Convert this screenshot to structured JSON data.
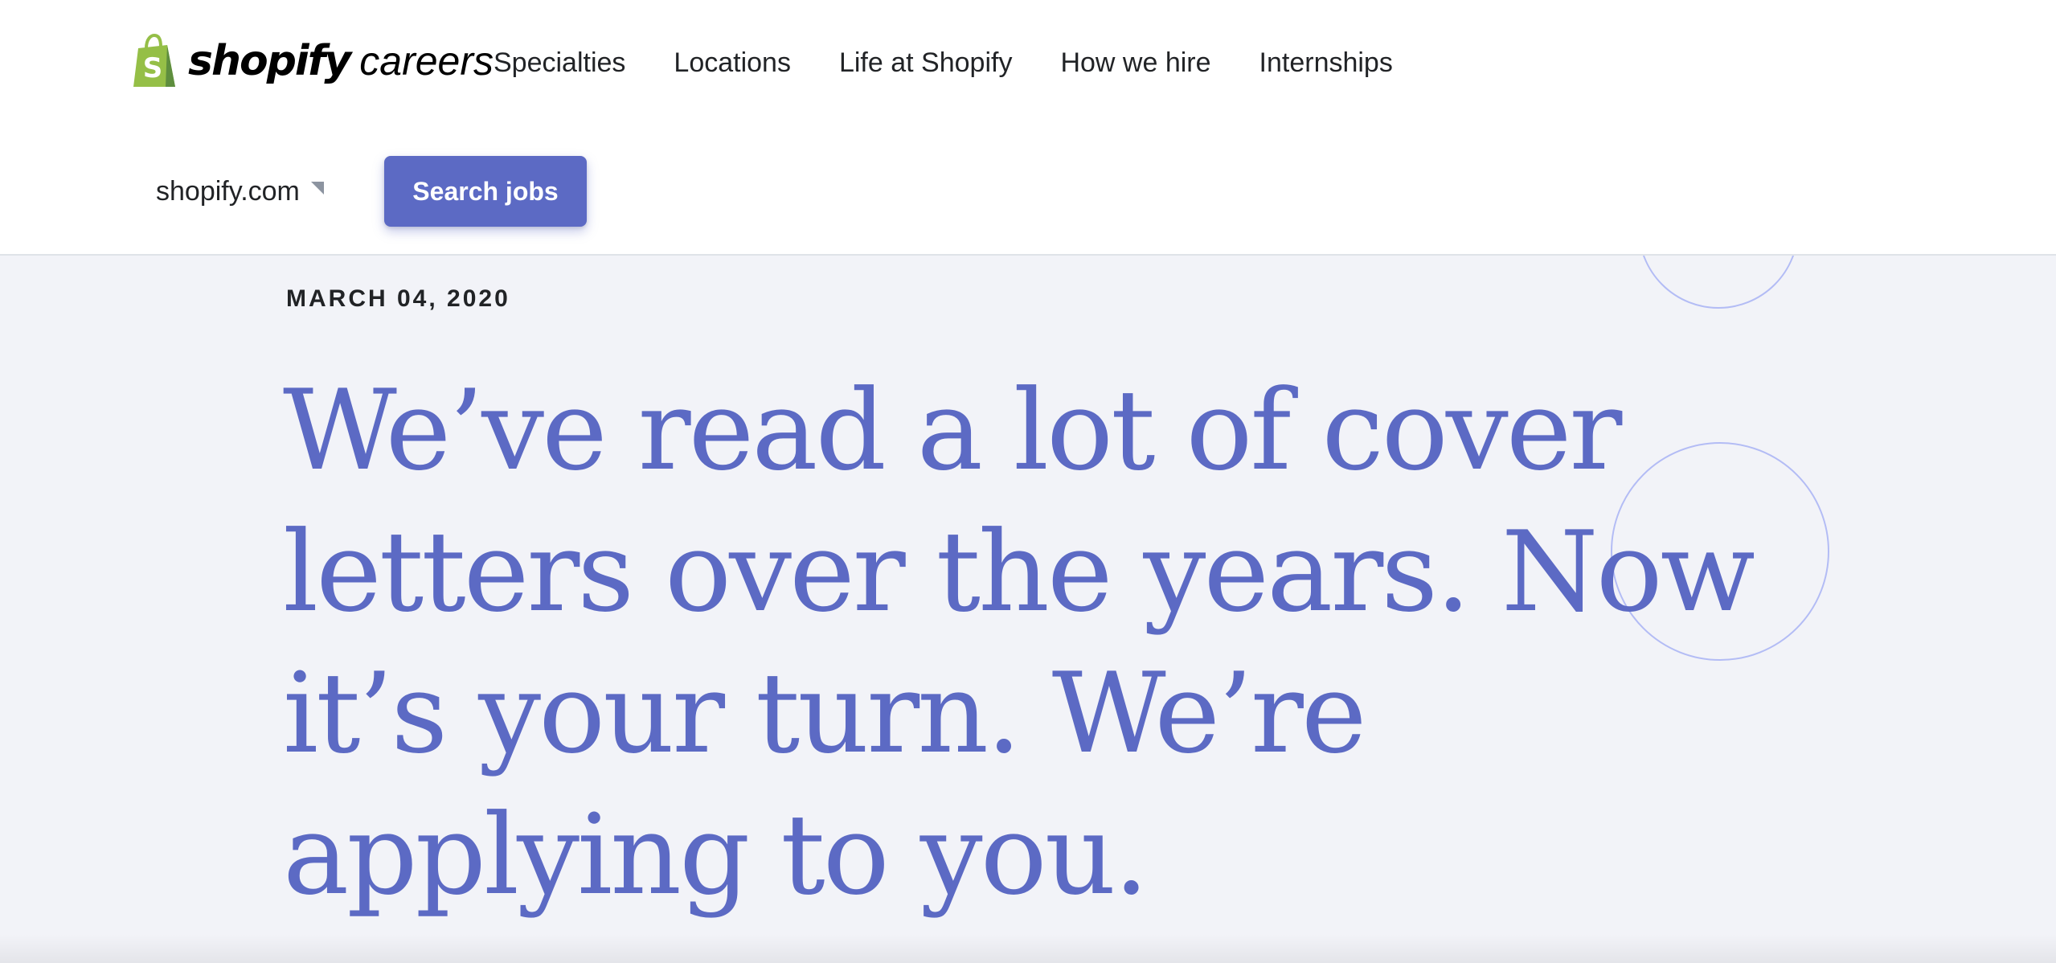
{
  "brand": {
    "wordmark": "shopify",
    "subtitle": "careers",
    "bag_color": "#95bf47",
    "bag_letter": "S"
  },
  "nav": {
    "items": [
      {
        "label": "Specialties"
      },
      {
        "label": "Locations"
      },
      {
        "label": "Life at Shopify"
      },
      {
        "label": "How we hire"
      },
      {
        "label": "Internships"
      }
    ]
  },
  "region_selector": {
    "label": "shopify.com",
    "icon": "caret-down-icon"
  },
  "search_button": {
    "label": "Search jobs"
  },
  "article": {
    "date": "MARCH 04, 2020",
    "headline": "We’ve read a lot of cover letters over the years. Now it’s your turn. We’re applying to you."
  },
  "colors": {
    "accent": "#5c6ac4",
    "hero_bg": "#f2f3f8",
    "text": "#212326",
    "decor_circle": "#b3bcf5"
  }
}
